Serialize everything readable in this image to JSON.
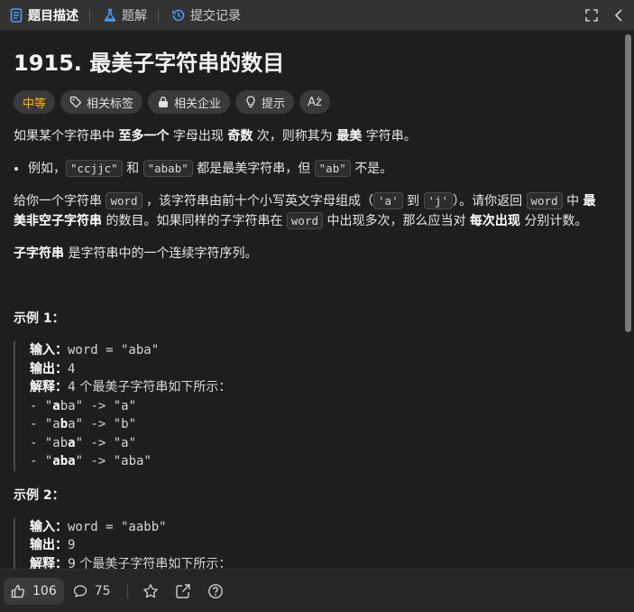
{
  "tabs": [
    {
      "label": "题目描述",
      "icon": "document-icon",
      "active": true
    },
    {
      "label": "题解",
      "icon": "flask-icon"
    },
    {
      "label": "提交记录",
      "icon": "history-icon"
    }
  ],
  "problem": {
    "title": "1915. 最美子字符串的数目",
    "difficulty": "中等",
    "tags": [
      "相关标签",
      "相关企业",
      "提示"
    ],
    "translate_label": "Aż",
    "desc1": {
      "a": "如果某个字符串中 ",
      "b1": "至多一个",
      "c": " 字母出现 ",
      "b2": "奇数",
      "d": " 次，则称其为 ",
      "b3": "最美",
      "e": " 字符串。"
    },
    "bullet": {
      "a": "例如，",
      "c1": "\"ccjjc\"",
      "b": " 和 ",
      "c2": "\"abab\"",
      "c": " 都是最美字符串，但 ",
      "c3": "\"ab\"",
      "d": " 不是。"
    },
    "desc2": {
      "a": "给你一个字符串 ",
      "c1": "word",
      "b": " ，该字符串由前十个小写英文字母组成（",
      "c2": "'a'",
      "c": " 到 ",
      "c3": "'j'",
      "d": "）。请你返回 ",
      "c4": "word",
      "e": " 中 ",
      "b1": "最美非空子字符串",
      "f": " 的数目。如果同样的子字符串在 ",
      "c5": "word",
      "g": " 中出现多次，那么应当对 ",
      "b2": "每次出现",
      "h": " 分别计数。"
    },
    "desc3": {
      "b1": "子字符串",
      "a": " 是字符串中的一个连续字符序列。"
    }
  },
  "example1": {
    "title": "示例 1：",
    "input_label": "输入：",
    "input_value": "word = \"aba\"",
    "output_label": "输出：",
    "output_value": "4",
    "explain_label": "解释：",
    "explain_value": "4 个最美子字符串如下所示：",
    "rows": [
      {
        "q1": "- \"",
        "pre": "",
        "bold": "a",
        "post": "ba",
        "q2": "\" -> \"a\""
      },
      {
        "q1": "- \"",
        "pre": "a",
        "bold": "b",
        "post": "a",
        "q2": "\" -> \"b\""
      },
      {
        "q1": "- \"",
        "pre": "ab",
        "bold": "a",
        "post": "",
        "q2": "\" -> \"a\""
      },
      {
        "q1": "- \"",
        "pre": "",
        "bold": "aba",
        "post": "",
        "q2": "\" -> \"aba\""
      }
    ]
  },
  "example2": {
    "title": "示例 2：",
    "input_label": "输入：",
    "input_value": "word = \"aabb\"",
    "output_label": "输出：",
    "output_value": "9",
    "explain_label": "解释：",
    "explain_value": "9 个最美子字符串如下所示："
  },
  "bottom": {
    "likes": "106",
    "comments": "75"
  },
  "colors": {
    "difficulty": "#ffb800",
    "background": "#1e1e1e",
    "tabbar": "#333333"
  }
}
